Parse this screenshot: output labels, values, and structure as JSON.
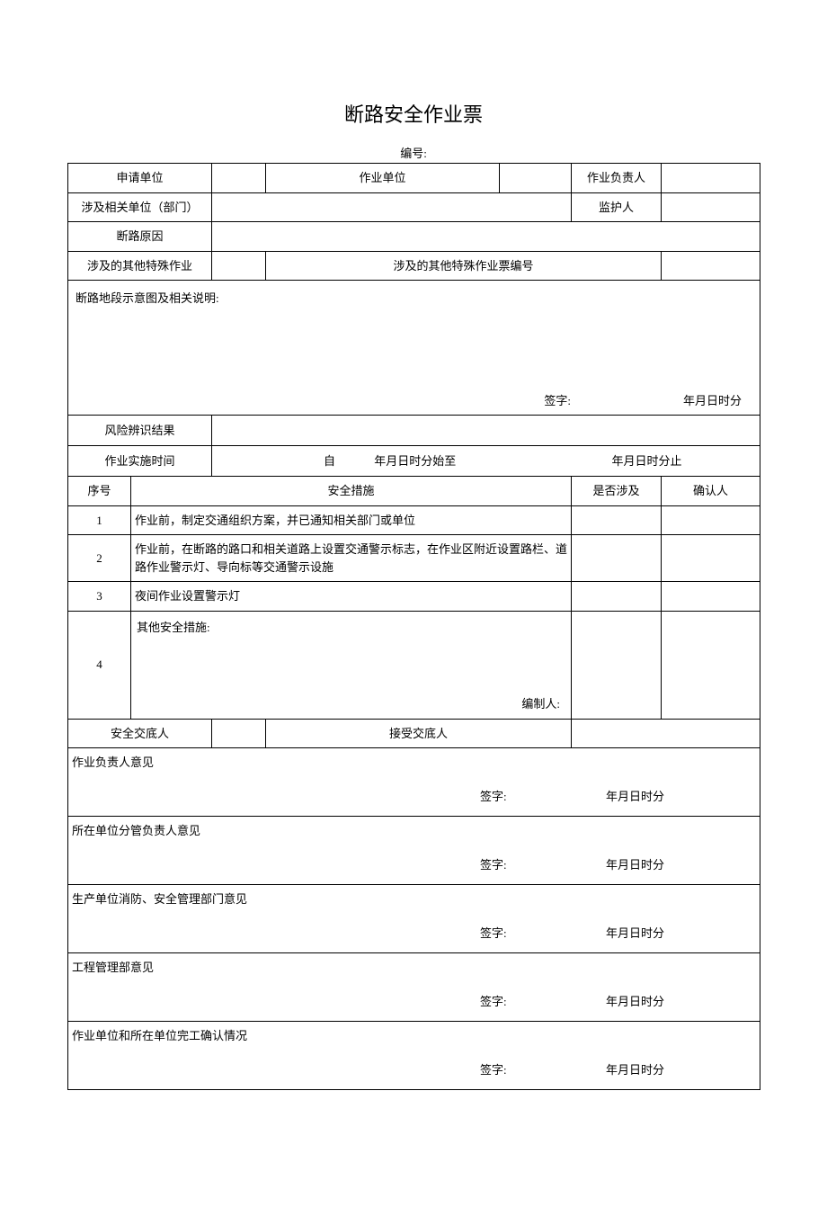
{
  "title": "断路安全作业票",
  "serial": {
    "label": "编号:"
  },
  "row1": {
    "applicant_unit": "申请单位",
    "work_unit": "作业单位",
    "work_leader": "作业负责人"
  },
  "row2": {
    "related_dept": "涉及相关单位（部门）",
    "guardian": "监护人"
  },
  "row3": {
    "reason": "断路原因"
  },
  "row4": {
    "other_ops": "涉及的其他特殊作业",
    "other_ops_no": "涉及的其他特殊作业票编号"
  },
  "diagram": {
    "header": "断路地段示意图及相关说明:",
    "sign": "签字:",
    "datetime": "年月日时分"
  },
  "risk": {
    "label": "风险辨识结果"
  },
  "time_row": {
    "label": "作业实施时间",
    "from": "自",
    "mid": "年月日时分始至",
    "end": "年月日时分止"
  },
  "measures": {
    "col_no": "序号",
    "col_measure": "安全措施",
    "col_involved": "是否涉及",
    "col_confirm": "确认人",
    "rows": [
      {
        "no": "1",
        "text": "作业前，制定交通组织方案，并已通知相关部门或单位"
      },
      {
        "no": "2",
        "text": "作业前，在断路的路口和相关道路上设置交通警示标志，在作业区附近设置路栏、道路作业警示灯、导向标等交通警示设施"
      },
      {
        "no": "3",
        "text": "夜间作业设置警示灯"
      },
      {
        "no": "4",
        "text": "其他安全措施:",
        "compiler": "编制人:"
      }
    ]
  },
  "disclosure": {
    "disclose_person": "安全交底人",
    "accept_person": "接受交底人"
  },
  "opinions": [
    {
      "title": "作业负责人意见",
      "sign": "签字:",
      "datetime": "年月日时分"
    },
    {
      "title": "所在单位分管负责人意见",
      "sign": "签字:",
      "datetime": "年月日时分"
    },
    {
      "title": "生产单位消防、安全管理部门意见",
      "sign": "签字:",
      "datetime": "年月日时分"
    },
    {
      "title": "工程管理部意见",
      "sign": "签字:",
      "datetime": "年月日时分"
    },
    {
      "title": "作业单位和所在单位完工确认情况",
      "sign": "签字:",
      "datetime": "年月日时分"
    }
  ]
}
